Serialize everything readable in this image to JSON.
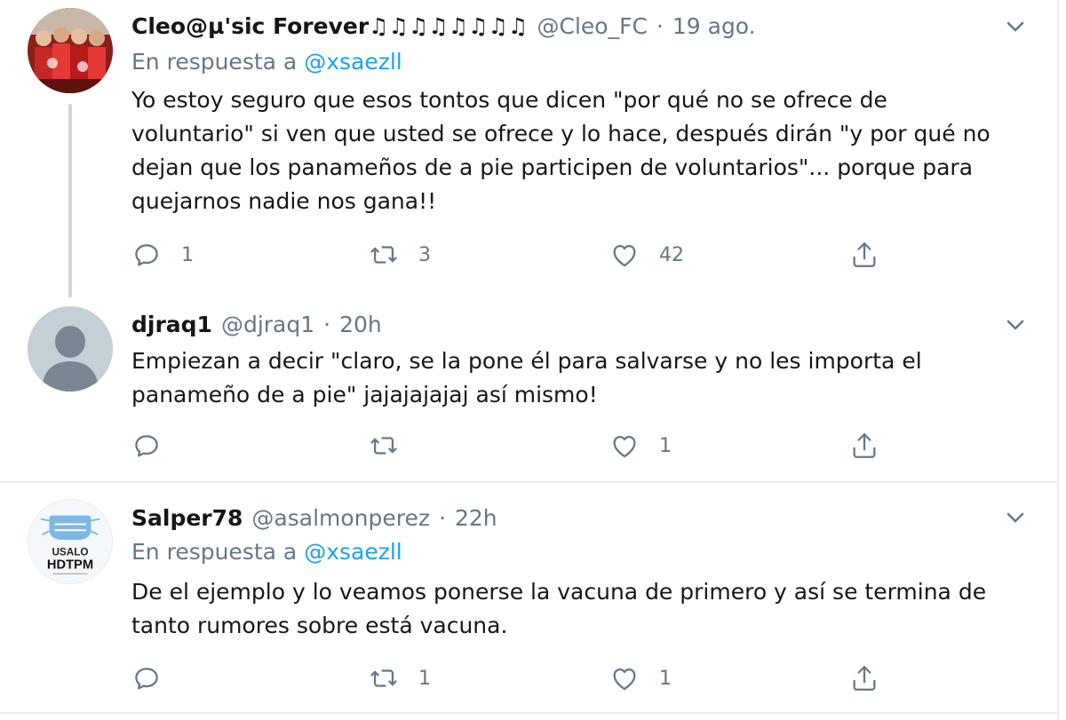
{
  "tweets": [
    {
      "name": "Cleo@µ'sic Forever♫♫♫♫♫♫♫♫",
      "handle": "@Cleo_FC",
      "separator": "·",
      "time": "19 ago.",
      "reply_prefix": "En respuesta a",
      "reply_to": "@xsaezll",
      "text_lines": [
        "Yo estoy seguro que esos tontos que dicen \"por qué no se ofrece de",
        "voluntario\" si ven que usted se ofrece y lo hace, después dirán \"y por qué no",
        "dejan que los panameños de a pie participen de voluntarios\"... porque para",
        "quejarnos nadie nos gana!!"
      ],
      "replies": "1",
      "retweets": "3",
      "likes": "42",
      "avatar": "red-group-photo"
    },
    {
      "name": "djraq1",
      "handle": "@djraq1",
      "separator": "·",
      "time": "20h",
      "text_lines": [
        "Empiezan a decir \"claro, se la pone él para salvarse y no les importa el",
        "panameño de a pie\" jajajajajaj así mismo!"
      ],
      "replies": "",
      "retweets": "",
      "likes": "1",
      "avatar": "default-person"
    },
    {
      "name": "Salper78",
      "handle": "@asalmonperez",
      "separator": "·",
      "time": "22h",
      "reply_prefix": "En respuesta a",
      "reply_to": "@xsaezll",
      "text_lines": [
        "De el ejemplo y lo veamos ponerse la vacuna de primero y así se termina de",
        "tanto rumores sobre está vacuna."
      ],
      "replies": "",
      "retweets": "1",
      "likes": "1",
      "avatar_logo_line1": "USALO",
      "avatar_logo_line2": "HDTPM"
    }
  ],
  "colors": {
    "text": "#14171a",
    "secondary": "#657786",
    "accent": "#1da1f2",
    "divider": "#e6ecf0",
    "thread_line": "#ccd6dd"
  },
  "icons": {
    "reply": "reply-icon",
    "retweet": "retweet-icon",
    "like": "heart-icon",
    "share": "share-icon",
    "menu": "chevron-down-icon"
  }
}
